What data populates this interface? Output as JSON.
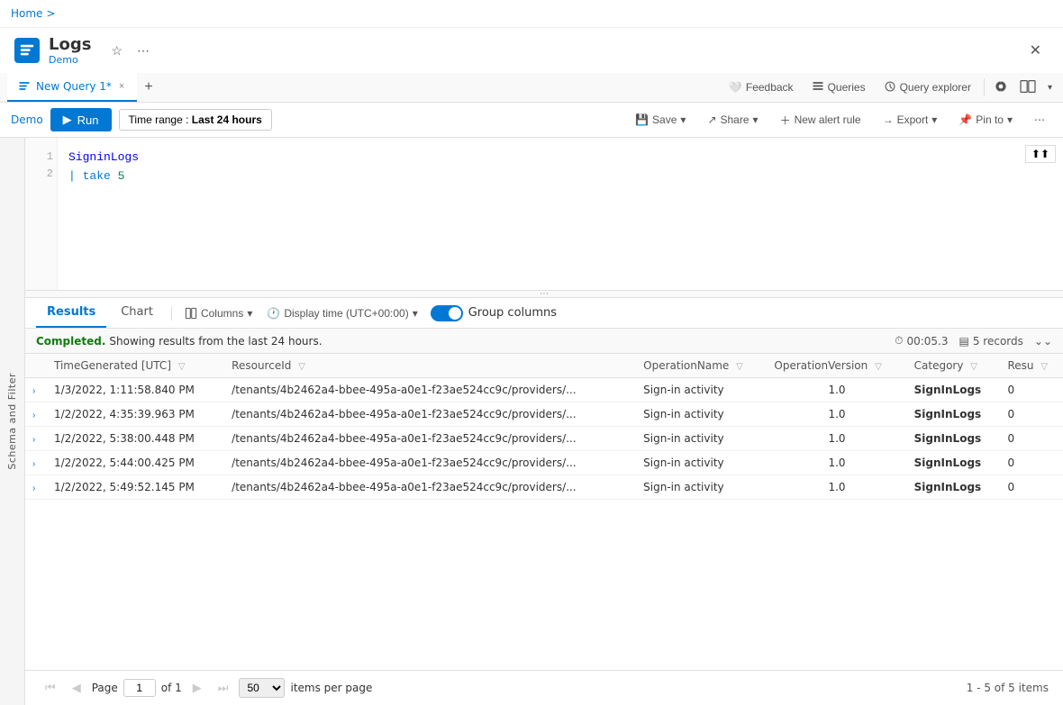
{
  "breadcrumb": {
    "home": "Home",
    "sep": ">"
  },
  "header": {
    "app_title": "Logs",
    "app_subtitle": "Demo",
    "favorite_icon": "★",
    "more_icon": "⋯",
    "close_icon": "✕"
  },
  "tabs": {
    "active_tab": "New Query 1*",
    "close_icon": "×",
    "add_icon": "+",
    "feedback_label": "Feedback",
    "queries_label": "Queries",
    "query_explorer_label": "Query explorer"
  },
  "toolbar": {
    "workspace_label": "Demo",
    "run_label": "Run",
    "time_range_prefix": "Time range : ",
    "time_range_value": "Last 24 hours",
    "save_label": "Save",
    "share_label": "Share",
    "new_alert_label": "New alert rule",
    "export_label": "Export",
    "pin_to_label": "Pin to",
    "more_icon": "⋯"
  },
  "editor": {
    "line1": "SigninLogs",
    "line2": "| take 5",
    "line_numbers": [
      "1",
      "2"
    ]
  },
  "resize": {
    "dots": "⋯"
  },
  "results": {
    "tabs": [
      {
        "label": "Results",
        "active": true
      },
      {
        "label": "Chart",
        "active": false
      }
    ],
    "columns_label": "Columns",
    "display_time_label": "Display time (UTC+00:00)",
    "group_columns_label": "Group columns",
    "status_text": "Completed.",
    "status_detail": " Showing results from the last 24 hours.",
    "time_icon": "⏱",
    "duration": "00:05.3",
    "records_icon": "▤",
    "records_count": "5 records",
    "expand_icon": "⌄⌄",
    "columns": [
      {
        "label": "TimeGenerated [UTC]"
      },
      {
        "label": "ResourceId"
      },
      {
        "label": "OperationName"
      },
      {
        "label": "OperationVersion"
      },
      {
        "label": "Category"
      },
      {
        "label": "Resu"
      }
    ],
    "rows": [
      {
        "time": "1/3/2022, 1:11:58.840 PM",
        "resource": "/tenants/4b2462a4-bbee-495a-a0e1-f23ae524cc9c/providers/...",
        "operation": "Sign-in activity",
        "version": "1.0",
        "category": "SignInLogs",
        "result": "0"
      },
      {
        "time": "1/2/2022, 4:35:39.963 PM",
        "resource": "/tenants/4b2462a4-bbee-495a-a0e1-f23ae524cc9c/providers/...",
        "operation": "Sign-in activity",
        "version": "1.0",
        "category": "SignInLogs",
        "result": "0"
      },
      {
        "time": "1/2/2022, 5:38:00.448 PM",
        "resource": "/tenants/4b2462a4-bbee-495a-a0e1-f23ae524cc9c/providers/...",
        "operation": "Sign-in activity",
        "version": "1.0",
        "category": "SignInLogs",
        "result": "0"
      },
      {
        "time": "1/2/2022, 5:44:00.425 PM",
        "resource": "/tenants/4b2462a4-bbee-495a-a0e1-f23ae524cc9c/providers/...",
        "operation": "Sign-in activity",
        "version": "1.0",
        "category": "SignInLogs",
        "result": "0"
      },
      {
        "time": "1/2/2022, 5:49:52.145 PM",
        "resource": "/tenants/4b2462a4-bbee-495a-a0e1-f23ae524cc9c/providers/...",
        "operation": "Sign-in activity",
        "version": "1.0",
        "category": "SignInLogs",
        "result": "0"
      }
    ]
  },
  "pagination": {
    "page_label": "Page",
    "current_page": "1",
    "of_label": "of 1",
    "items_per_page_label": "items per page",
    "items_per_page_value": "50",
    "summary": "1 - 5 of 5 items"
  },
  "schema_sidebar": {
    "label": "Schema and Filter"
  },
  "colors": {
    "accent": "#0078d4",
    "success": "#107c10"
  }
}
